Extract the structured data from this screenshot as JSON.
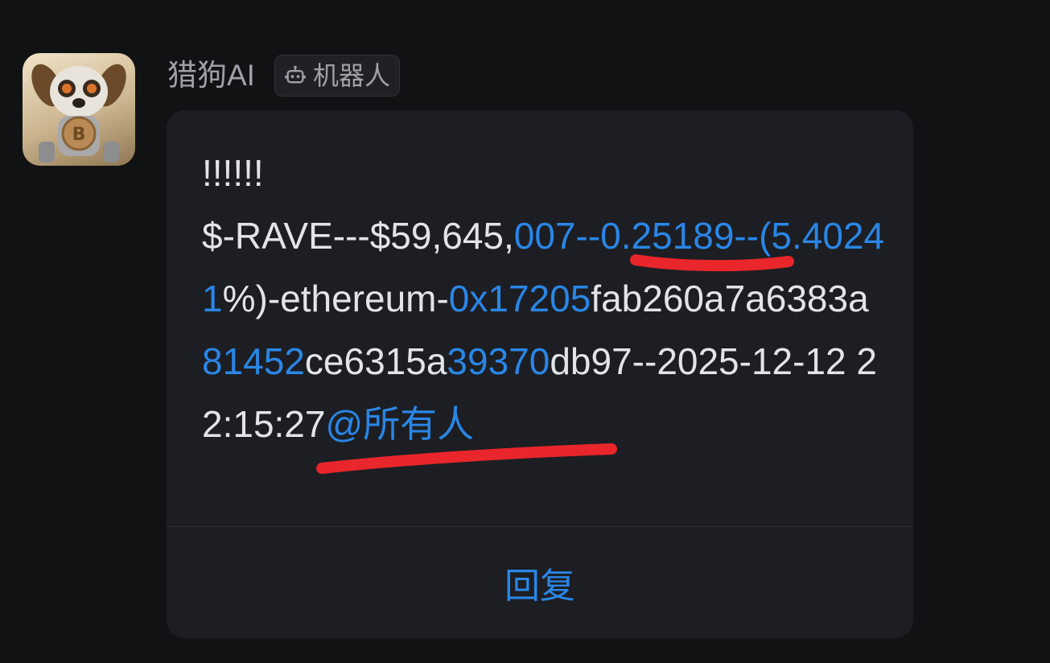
{
  "sender": {
    "name": "猎狗AI",
    "badge_label": "机器人",
    "badge_icon": "robot-icon",
    "avatar_icon": "robot-dog-bitcoin-icon"
  },
  "message": {
    "line1": "!!!!!!",
    "seg1": "$-RAVE---$59,645,",
    "seg2": "007--0.25189--(5.40241",
    "seg3": "%)-ethereum-",
    "seg4": "0x17205",
    "seg5": "fab260a7a6383a",
    "seg6": "81452",
    "seg7": "ce6315a",
    "seg8": "39370",
    "seg9": "db97--2025-12-12 22:15:27",
    "mention": "@所有人"
  },
  "actions": {
    "reply_label": "回复"
  },
  "colors": {
    "background": "#111214",
    "card": "#1c1e23",
    "text": "#e2e4e8",
    "muted": "#9ea1a7",
    "link": "#2a86e6",
    "annotation": "#e8262b"
  }
}
